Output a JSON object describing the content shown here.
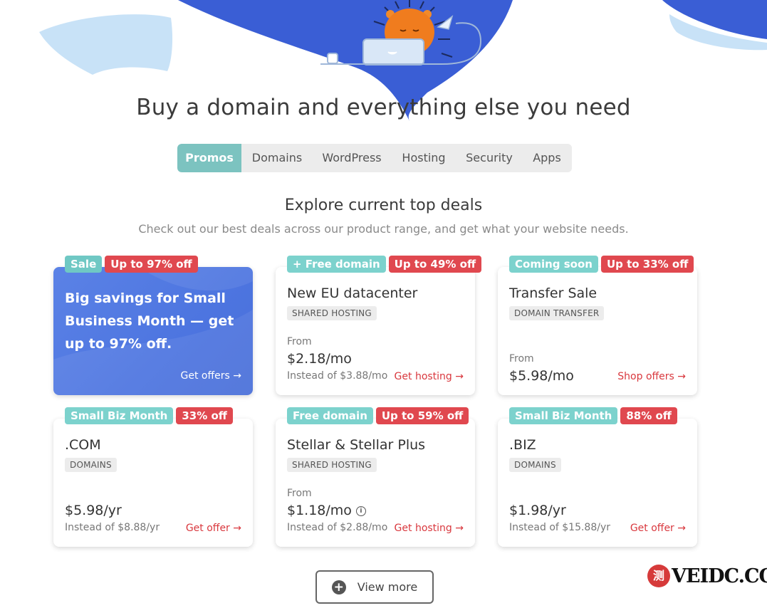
{
  "headline": "Buy a domain and everything else you need",
  "tabs": [
    {
      "label": "Promos",
      "active": true
    },
    {
      "label": "Domains"
    },
    {
      "label": "WordPress"
    },
    {
      "label": "Hosting"
    },
    {
      "label": "Security"
    },
    {
      "label": "Apps"
    }
  ],
  "section": {
    "title": "Explore current top deals",
    "subtitle": "Check out our best deals across our product range, and get what your website needs."
  },
  "cards": [
    {
      "badges": [
        "Sale",
        "Up to 97% off"
      ],
      "text": "Big savings for Small Business Month — get up to 97% off.",
      "cta": "Get offers →"
    },
    {
      "badges": [
        "+ Free domain",
        "Up to 49% off"
      ],
      "title": "New EU datacenter",
      "chip": "SHARED HOSTING",
      "from": "From",
      "price": "$2.18/mo",
      "instead": "Instead of $3.88/mo",
      "cta": "Get hosting →"
    },
    {
      "badges": [
        "Coming soon",
        "Up to 33% off"
      ],
      "title": "Transfer Sale",
      "chip": "DOMAIN TRANSFER",
      "from": "From",
      "price": "$5.98/mo",
      "cta": "Shop offers →"
    },
    {
      "badges": [
        "Small Biz Month",
        "33% off"
      ],
      "title": ".COM",
      "chip": "DOMAINS",
      "price": "$5.98/yr",
      "instead": "Instead of $8.88/yr",
      "cta": "Get offer →"
    },
    {
      "badges": [
        "Free domain",
        "Up to 59% off"
      ],
      "title": "Stellar & Stellar Plus",
      "chip": "SHARED HOSTING",
      "from": "From",
      "price": "$1.18/mo",
      "instead": "Instead of $2.88/mo",
      "cta": "Get hosting →"
    },
    {
      "badges": [
        "Small Biz Month",
        "88% off"
      ],
      "title": ".BIZ",
      "chip": "DOMAINS",
      "price": "$1.98/yr",
      "instead": "Instead of $15.88/yr",
      "cta": "Get offer →"
    }
  ],
  "view_more": "View more",
  "watermark": {
    "logo": "测",
    "text": "VEIDC.COM"
  },
  "colors": {
    "accent_teal": "#7cc3c0",
    "badge_red": "#e0484f",
    "hero_blue": "#3b5fd4",
    "promo_blue": "#5279e2"
  }
}
